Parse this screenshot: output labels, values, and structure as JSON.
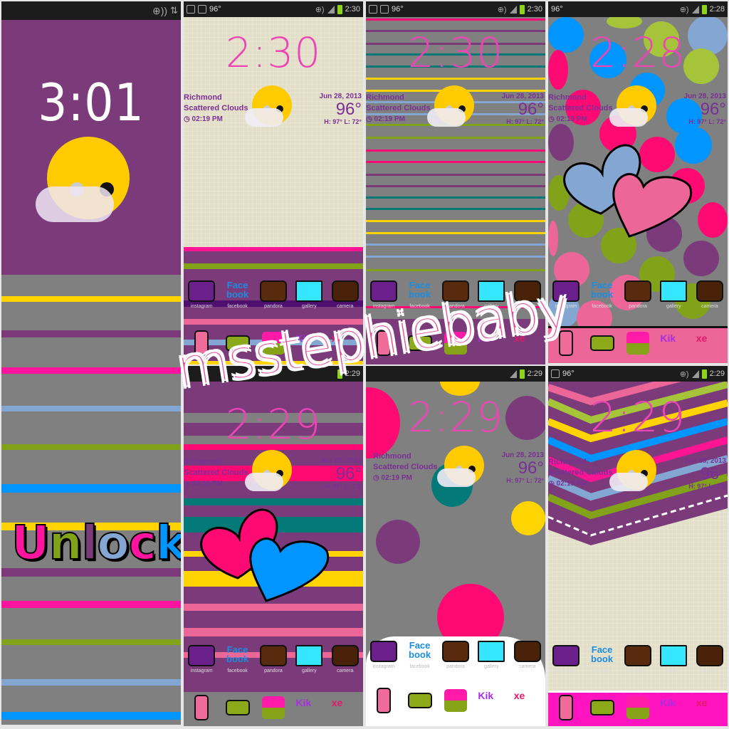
{
  "watermark": "msstephiebaby",
  "colors": {
    "purple": "#7b3b7b",
    "pink": "#ff1493",
    "hotpink": "#ff0a73",
    "yellow": "#ffd400",
    "blue": "#0095ff",
    "lightblue": "#84a6d2",
    "green": "#82a21a",
    "gray": "#808080",
    "teal": "#037a78",
    "clock": "#ec45b4"
  },
  "lockscreen": {
    "clock": "3:01",
    "unlock_label": [
      "U",
      "n",
      "l",
      "o",
      "c",
      "k"
    ]
  },
  "weather": {
    "location": "Richmond",
    "condition": "Scattered Clouds",
    "updated": "02:19 PM",
    "date": "Jun 28, 2013",
    "temp": "96°",
    "hilo": "H: 97° L: 72°"
  },
  "status": {
    "temp": "96°"
  },
  "screens": [
    {
      "id": "beige",
      "clock": "2:30",
      "status_time": "2:30"
    },
    {
      "id": "stripes",
      "clock": "2:30",
      "status_time": "2:30"
    },
    {
      "id": "dots",
      "clock": "2:28",
      "status_time": "2:28"
    },
    {
      "id": "purple-stripes",
      "clock": "2:29",
      "status_time": "2:29"
    },
    {
      "id": "gray-dots",
      "clock": "2:29",
      "status_time": "2:29"
    },
    {
      "id": "chevron",
      "clock": "2:29",
      "status_time": "2:29"
    }
  ],
  "apps": {
    "row1": [
      {
        "name": "instagram",
        "label": "instagram"
      },
      {
        "name": "facebook",
        "label": "facebook"
      },
      {
        "name": "pandora",
        "label": "pandora"
      },
      {
        "name": "gallery",
        "label": "gallery"
      },
      {
        "name": "camera",
        "label": "camera"
      }
    ],
    "row2": [
      {
        "name": "phone",
        "label": ""
      },
      {
        "name": "messaging",
        "label": ""
      },
      {
        "name": "multi",
        "label": ""
      },
      {
        "name": "kik",
        "label": "Kik"
      },
      {
        "name": "xe",
        "label": "xe"
      }
    ],
    "facebook_glyph": "Face book",
    "msg_glyph": "♥♥♥"
  }
}
